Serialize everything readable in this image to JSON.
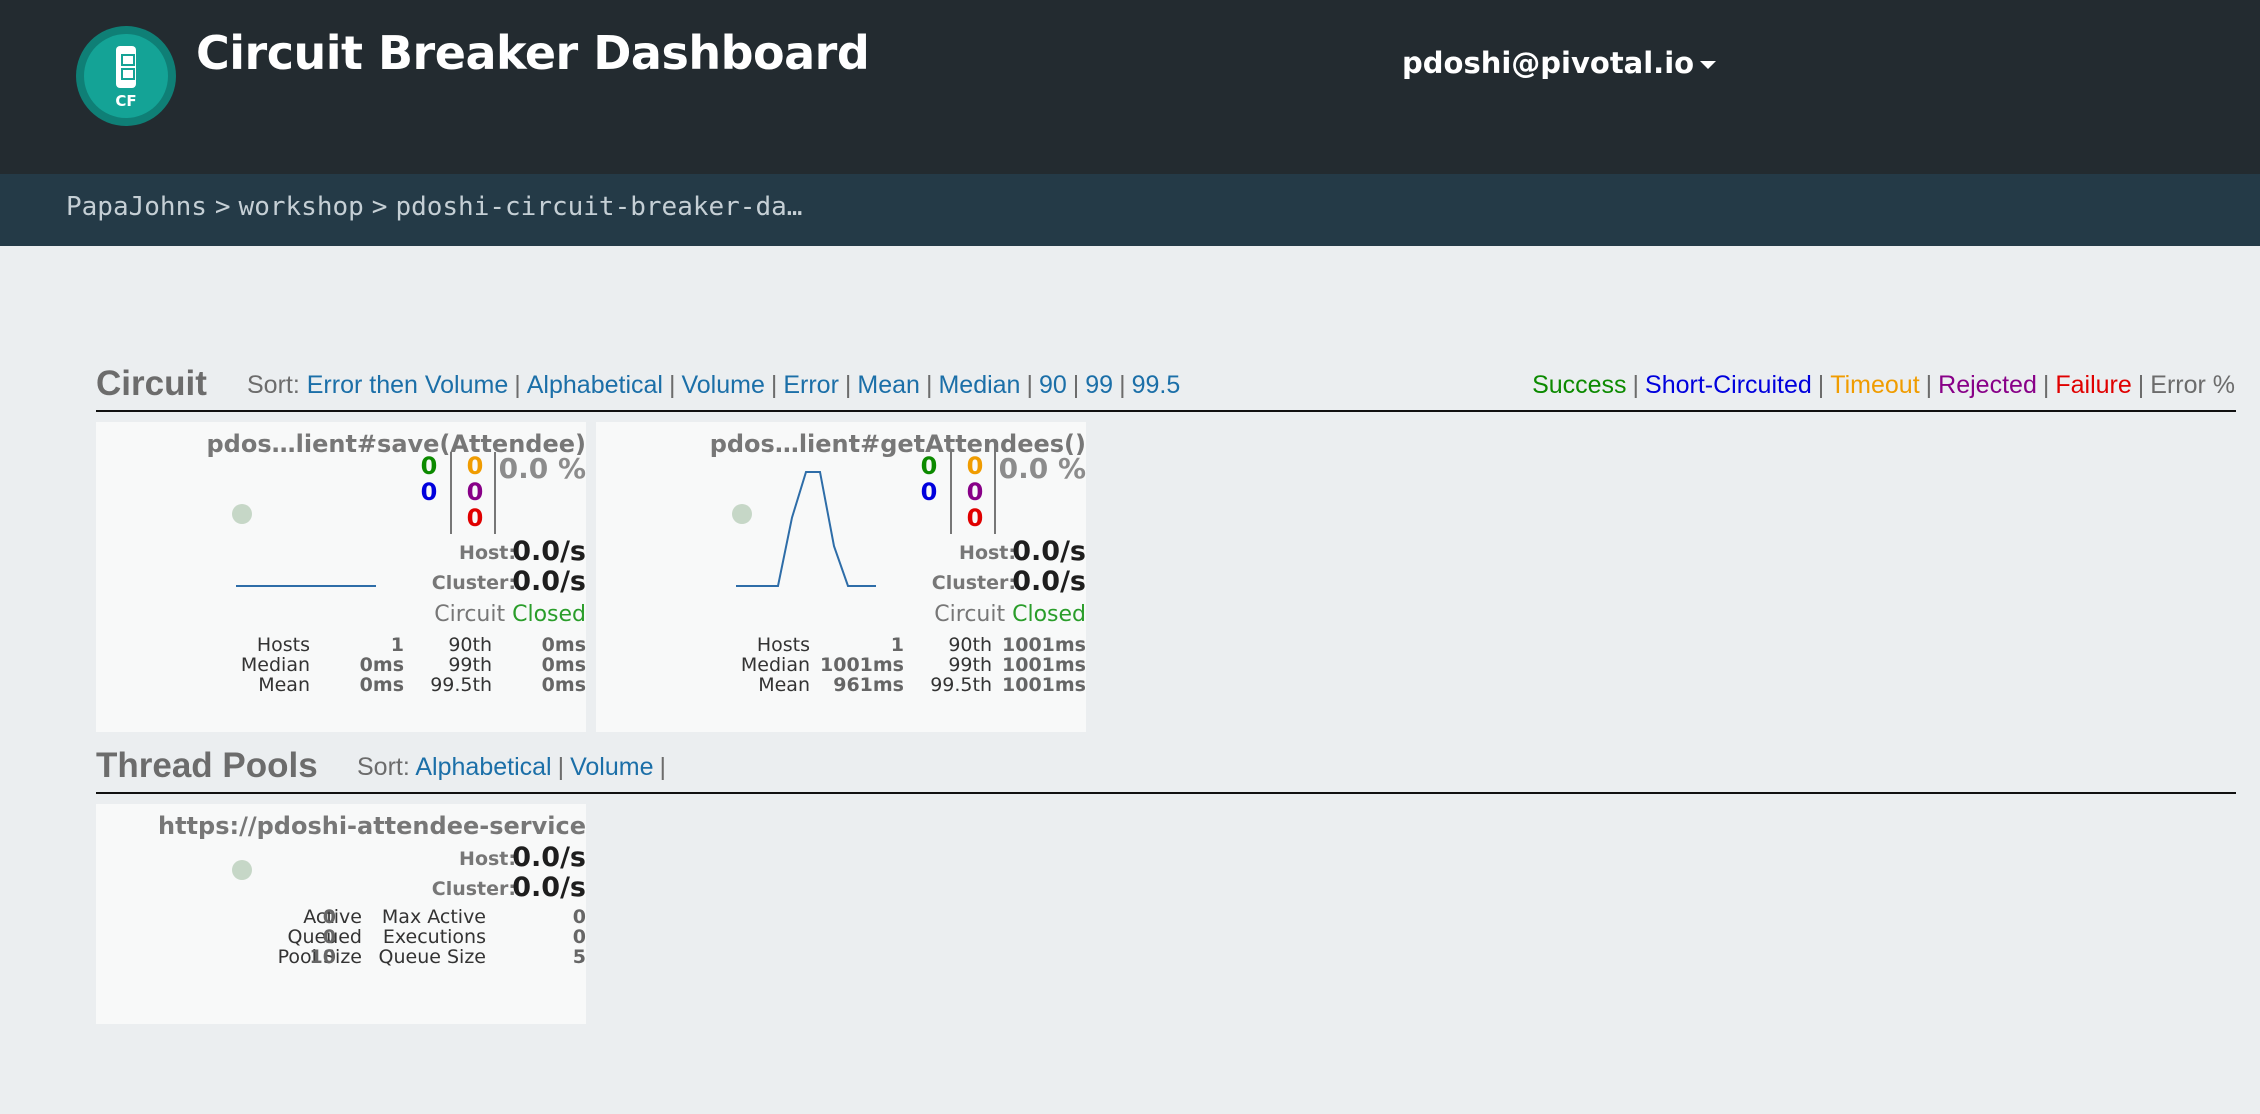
{
  "app": {
    "title": "Circuit Breaker Dashboard",
    "logo_text": "CF",
    "user": "pdoshi@pivotal.io"
  },
  "breadcrumb": [
    "PapaJohns",
    "workshop",
    "pdoshi-circuit-breaker-da…"
  ],
  "circuit_section": {
    "title": "Circuit",
    "sort_label": "Sort:",
    "sort_options": [
      "Error then Volume",
      "Alphabetical",
      "Volume",
      "Error",
      "Mean",
      "Median",
      "90",
      "99",
      "99.5"
    ],
    "legend": [
      {
        "label": "Success",
        "color": "#0c8a00"
      },
      {
        "label": "Short-Circuited",
        "color": "#0000dd"
      },
      {
        "label": "Timeout",
        "color": "#f09c00"
      },
      {
        "label": "Rejected",
        "color": "#880088"
      },
      {
        "label": "Failure",
        "color": "#e00000"
      },
      {
        "label": "Error %",
        "color": "#6c6c6c"
      }
    ]
  },
  "circuits": [
    {
      "name": "pdos…lient#save(Attendee)",
      "counts": {
        "success": "0",
        "short_circuited": "0",
        "timeout": "0",
        "rejected": "0",
        "failure": "0"
      },
      "error_pct": "0.0 %",
      "host_label": "Host:",
      "host_rate": "0.0/s",
      "cluster_label": "Cluster:",
      "cluster_rate": "0.0/s",
      "circuit_label": "Circuit",
      "circuit_state": "Closed",
      "stats": {
        "hosts_label": "Hosts",
        "hosts": "1",
        "median_label": "Median",
        "median": "0ms",
        "mean_label": "Mean",
        "mean": "0ms",
        "p90_label": "90th",
        "p90": "0ms",
        "p99_label": "99th",
        "p99": "0ms",
        "p995_label": "99.5th",
        "p995": "0ms"
      },
      "sparkline": [
        0,
        0,
        0,
        0,
        0,
        0,
        0,
        0,
        0,
        0
      ]
    },
    {
      "name": "pdos…lient#getAttendees()",
      "counts": {
        "success": "0",
        "short_circuited": "0",
        "timeout": "0",
        "rejected": "0",
        "failure": "0"
      },
      "error_pct": "0.0 %",
      "host_label": "Host:",
      "host_rate": "0.0/s",
      "cluster_label": "Cluster:",
      "cluster_rate": "0.0/s",
      "circuit_label": "Circuit",
      "circuit_state": "Closed",
      "stats": {
        "hosts_label": "Hosts",
        "hosts": "1",
        "median_label": "Median",
        "median": "1001ms",
        "mean_label": "Mean",
        "mean": "961ms",
        "p90_label": "90th",
        "p90": "1001ms",
        "p99_label": "99th",
        "p99": "1001ms",
        "p995_label": "99.5th",
        "p995": "1001ms"
      },
      "sparkline": [
        0,
        0,
        0,
        0,
        0.6,
        1,
        1,
        0.35,
        0,
        0,
        0
      ]
    }
  ],
  "thread_section": {
    "title": "Thread Pools",
    "sort_label": "Sort:",
    "sort_options": [
      "Alphabetical",
      "Volume"
    ]
  },
  "thread_pools": [
    {
      "name": "https://pdoshi-attendee-service",
      "host_label": "Host:",
      "host_rate": "0.0/s",
      "cluster_label": "Cluster:",
      "cluster_rate": "0.0/s",
      "stats": {
        "active_label": "Active",
        "active": "0",
        "queued_label": "Queued",
        "queued": "0",
        "pool_size_label": "Pool Size",
        "pool_size": "10",
        "max_active_label": "Max Active",
        "max_active": "0",
        "executions_label": "Executions",
        "executions": "0",
        "queue_size_label": "Queue Size",
        "queue_size": "5"
      }
    }
  ],
  "colors": {
    "success": "#0c8a00",
    "short_circuited": "#0000dd",
    "timeout": "#f09c00",
    "rejected": "#880088",
    "failure": "#e00000",
    "closed": "#2a9d2a",
    "link": "#1b6fa8",
    "sparkline": "#2e6da8"
  }
}
